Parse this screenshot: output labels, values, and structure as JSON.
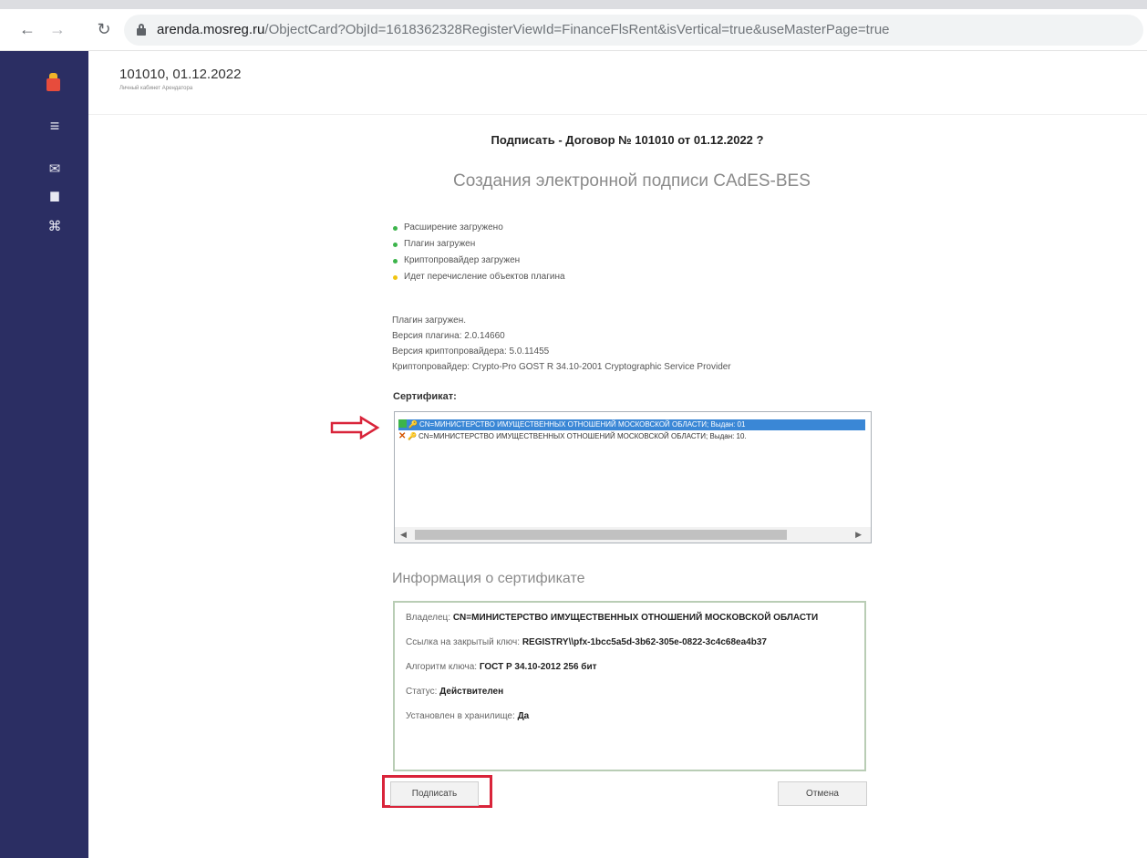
{
  "browser": {
    "back_icon": "back-arrow-icon",
    "forward_icon": "forward-arrow-icon",
    "reload_icon": "reload-icon",
    "url_host": "arenda.mosreg.ru",
    "url_path": "/ObjectCard?ObjId=1618362328RegisterViewId=FinanceFlsRent&isVertical=true&useMasterPage=true"
  },
  "sidebar": {
    "items": [
      {
        "icon": "logo-icon"
      },
      {
        "icon": "menu-icon",
        "glyph": "≡"
      },
      {
        "icon": "mail-icon",
        "glyph": "✉"
      },
      {
        "icon": "document-icon",
        "glyph": "▆"
      },
      {
        "icon": "network-icon",
        "glyph": "⌘"
      }
    ]
  },
  "header": {
    "title": "101010, 01.12.2022",
    "subtitle": "Личный кабинет Арендатора"
  },
  "dialog": {
    "question": "Подписать - Договор № 101010 от 01.12.2022 ?",
    "heading": "Создания электронной подписи CAdES-BES",
    "statuses": [
      {
        "text": "Расширение загружено",
        "color": "#3cb44b"
      },
      {
        "text": "Плагин загружен",
        "color": "#3cb44b"
      },
      {
        "text": "Криптопровайдер загружен",
        "color": "#3cb44b"
      },
      {
        "text": "Идет перечисление объектов плагина",
        "color": "#f1c40f"
      }
    ],
    "plugin_info": [
      "Плагин загружен.",
      "Версия плагина: 2.0.14660",
      "Версия криптопровайдера: 5.0.11455",
      "Криптопровайдер: Crypto-Pro GOST R 34.10-2001 Cryptographic Service Provider"
    ],
    "cert_label": "Сертификат:",
    "certificates": [
      {
        "text": "CN=МИНИСТЕРСТВО ИМУЩЕСТВЕННЫХ ОТНОШЕНИЙ МОСКОВСКОЙ ОБЛАСТИ; Выдан: 01",
        "valid": true,
        "selected": true
      },
      {
        "text": "CN=МИНИСТЕРСТВО ИМУЩЕСТВЕННЫХ ОТНОШЕНИЙ МОСКОВСКОЙ ОБЛАСТИ; Выдан: 10.",
        "valid": false,
        "selected": false
      }
    ],
    "info_heading": "Информация о сертификате",
    "info": {
      "owner_label": "Владелец:",
      "owner_value": "CN=МИНИСТЕРСТВО ИМУЩЕСТВЕННЫХ ОТНОШЕНИЙ МОСКОВСКОЙ ОБЛАСТИ",
      "key_link_label": "Ссылка на закрытый ключ:",
      "key_link_value": "REGISTRY\\\\pfx-1bcc5a5d-3b62-305e-0822-3c4c68ea4b37",
      "algo_label": "Алгоритм ключа:",
      "algo_value": "ГОСТ Р 34.10-2012 256 бит",
      "status_label": "Статус:",
      "status_value": "Действителен",
      "installed_label": "Установлен в хранилище:",
      "installed_value": "Да"
    },
    "sign_button": "Подписать",
    "cancel_button": "Отмена"
  },
  "annotations": {
    "arrow_color": "#d9243a",
    "highlight_color": "#d9243a"
  }
}
